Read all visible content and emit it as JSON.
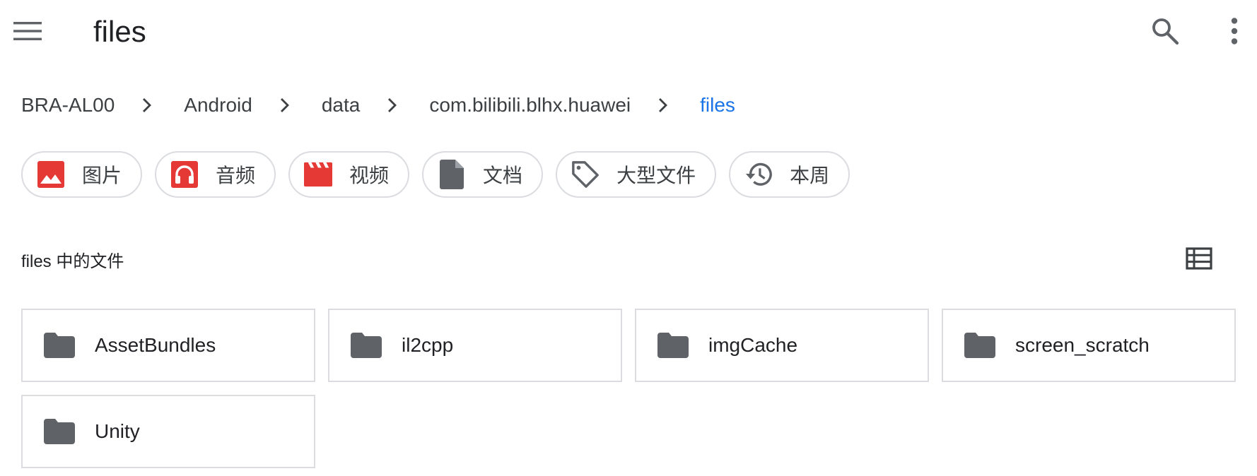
{
  "header": {
    "title": "files",
    "menu_icon": "hamburger-menu-icon",
    "search_icon": "search-icon",
    "more_icon": "more-vert-icon"
  },
  "breadcrumb": [
    {
      "label": "BRA-AL00",
      "active": false
    },
    {
      "label": "Android",
      "active": false
    },
    {
      "label": "data",
      "active": false
    },
    {
      "label": "com.bilibili.blhx.huawei",
      "active": false
    },
    {
      "label": "files",
      "active": true
    }
  ],
  "chips": [
    {
      "label": "图片",
      "icon": "image-icon",
      "color": "#e53935"
    },
    {
      "label": "音频",
      "icon": "headphones-icon",
      "color": "#e53935"
    },
    {
      "label": "视频",
      "icon": "video-icon",
      "color": "#e53935"
    },
    {
      "label": "文档",
      "icon": "document-icon",
      "color": "#5f6368"
    },
    {
      "label": "大型文件",
      "icon": "tag-icon",
      "color": "#5f6368"
    },
    {
      "label": "本周",
      "icon": "history-icon",
      "color": "#5f6368"
    }
  ],
  "section": {
    "label": "files 中的文件",
    "view_toggle_icon": "list-view-icon"
  },
  "folders": [
    {
      "name": "AssetBundles"
    },
    {
      "name": "il2cpp"
    },
    {
      "name": "imgCache"
    },
    {
      "name": "screen_scratch"
    },
    {
      "name": "Unity"
    }
  ],
  "colors": {
    "accent": "#1a73e8",
    "red_icon": "#e53935",
    "grey_icon": "#5f6368",
    "border": "#dadce0"
  }
}
